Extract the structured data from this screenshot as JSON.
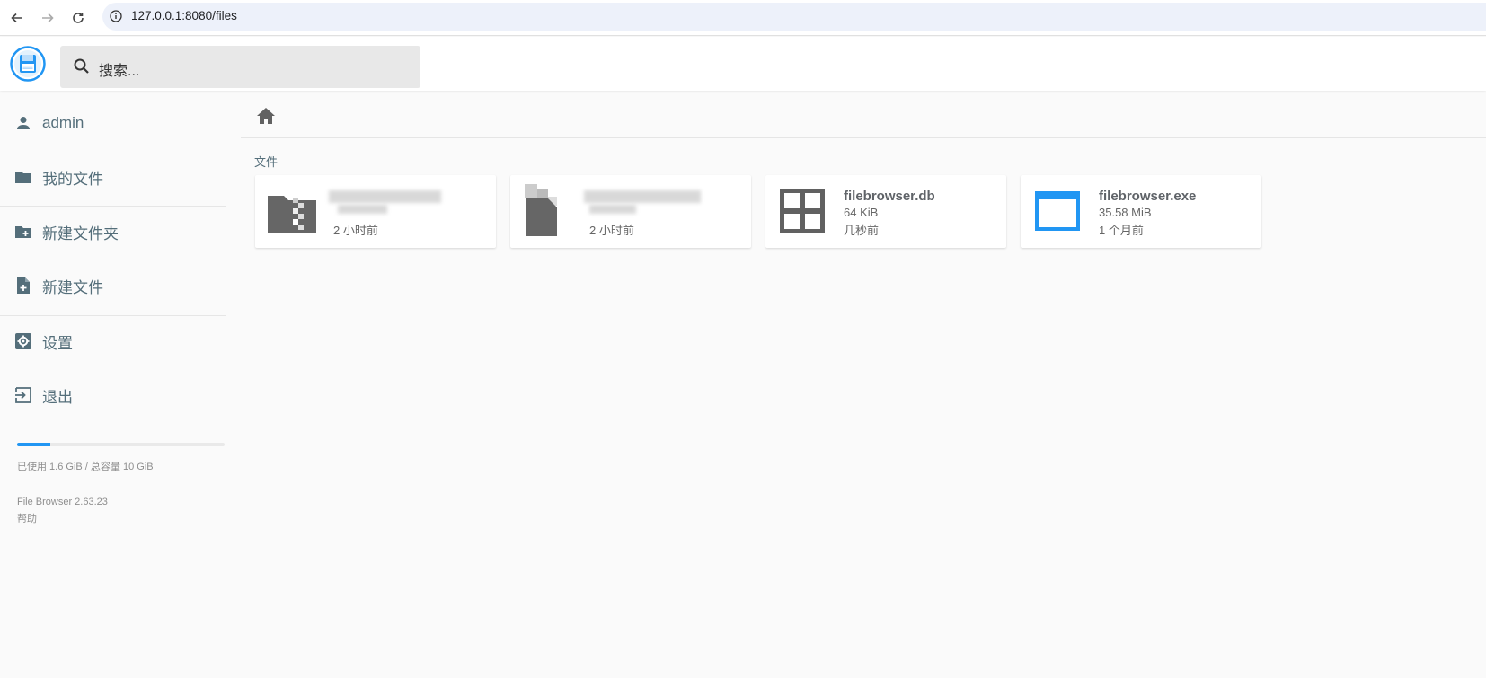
{
  "browser": {
    "url": "127.0.0.1:8080/files"
  },
  "header": {
    "search_placeholder": "搜索..."
  },
  "sidebar": {
    "user": "admin",
    "items": [
      {
        "label": "我的文件",
        "icon": "folder-icon"
      },
      {
        "label": "新建文件夹",
        "icon": "new-folder-icon"
      },
      {
        "label": "新建文件",
        "icon": "new-file-icon"
      },
      {
        "label": "设置",
        "icon": "settings-icon"
      },
      {
        "label": "退出",
        "icon": "logout-icon"
      }
    ],
    "usage": {
      "text": "已使用 1.6 GiB / 总容量 10 GiB",
      "fraction": 0.16
    },
    "version": "File Browser 2.63.23",
    "help": "帮助"
  },
  "main": {
    "section_title": "文件",
    "files": [
      {
        "name": "",
        "size": "",
        "modified": "2 小时前",
        "icon": "archive-file-icon",
        "blurred": true
      },
      {
        "name": "",
        "size": "",
        "modified": "2 小时前",
        "icon": "file-icon",
        "blurred": true
      },
      {
        "name": "filebrowser.db",
        "size": "64 KiB",
        "modified": "几秒前",
        "icon": "database-grid-icon",
        "blurred": false
      },
      {
        "name": "filebrowser.exe",
        "size": "35.58 MiB",
        "modified": "1 个月前",
        "icon": "application-window-icon",
        "blurred": false
      }
    ]
  },
  "colors": {
    "accent": "#2196f3",
    "sidebar_text": "#546e7a",
    "icon_gray": "#616161"
  }
}
